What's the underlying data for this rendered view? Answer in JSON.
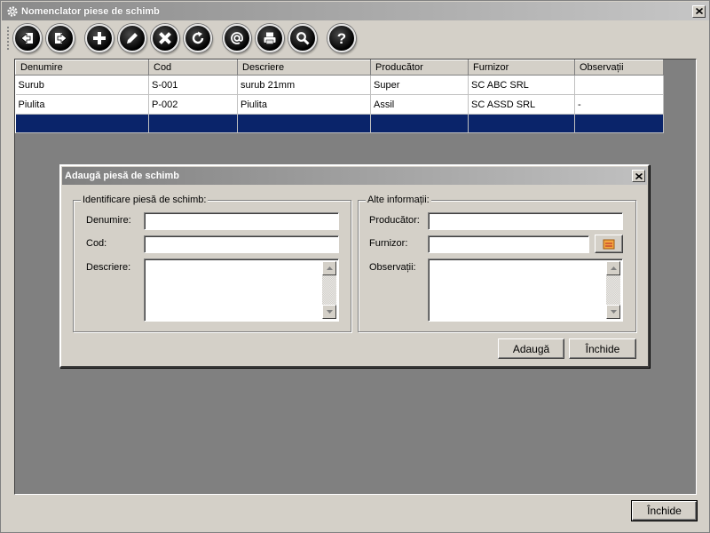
{
  "window": {
    "title": "Nomenclator piese de schimb"
  },
  "toolbar": {
    "buttons": [
      {
        "name": "back-icon"
      },
      {
        "name": "exit-icon"
      },
      {
        "name": "add-icon"
      },
      {
        "name": "edit-icon"
      },
      {
        "name": "delete-icon"
      },
      {
        "name": "refresh-icon"
      },
      {
        "name": "email-icon"
      },
      {
        "name": "print-icon"
      },
      {
        "name": "search-icon"
      },
      {
        "name": "help-icon"
      }
    ]
  },
  "grid": {
    "columns": [
      "Denumire",
      "Cod",
      "Descriere",
      "Producător",
      "Furnizor",
      "Observații"
    ],
    "rows": [
      [
        "Surub",
        "S-001",
        "surub 21mm",
        "Super",
        "SC ABC SRL",
        ""
      ],
      [
        "Piulita",
        "P-002",
        "Piulita",
        "Assil",
        "SC ASSD SRL",
        "-"
      ]
    ]
  },
  "dialog": {
    "title": "Adaugă piesă de schimb",
    "group_left": {
      "legend": "Identificare piesă de schimb:",
      "denumire_label": "Denumire:",
      "cod_label": "Cod:",
      "descriere_label": "Descriere:",
      "denumire_value": "",
      "cod_value": "",
      "descriere_value": ""
    },
    "group_right": {
      "legend": "Alte informații:",
      "producator_label": "Producător:",
      "furnizor_label": "Furnizor:",
      "observatii_label": "Observații:",
      "producator_value": "",
      "furnizor_value": "",
      "observatii_value": ""
    },
    "add_button": "Adaugă",
    "close_button": "Închide"
  },
  "footer": {
    "close_button": "Închide"
  },
  "colors": {
    "selected_row": "#0a246a",
    "window_bg": "#d4d0c8",
    "mdi_bg": "#808080"
  }
}
